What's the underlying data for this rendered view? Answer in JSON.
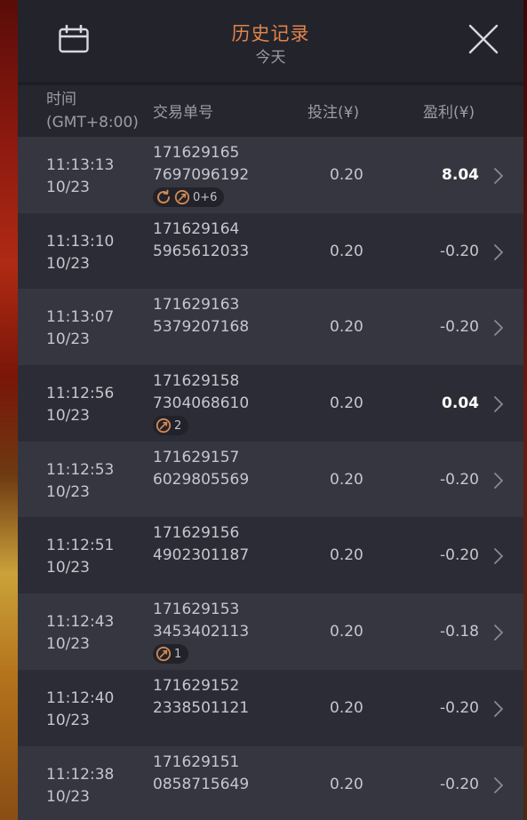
{
  "header": {
    "title": "历史记录",
    "subtitle": "今天"
  },
  "columns": {
    "time": "时间",
    "timezone": "(GMT+8:00)",
    "order": "交易单号",
    "bet": "投注(¥)",
    "profit": "盈利(¥)"
  },
  "colors": {
    "accent": "#e0844a",
    "panel_bg": "#2c2c36",
    "row_alt_bg": "#363641",
    "header_bg": "#23232b"
  },
  "rows": [
    {
      "time": "11:13:13",
      "date": "10/23",
      "order_a": "171629165",
      "order_b": "7697096192",
      "bet": "0.20",
      "profit": "8.04",
      "win": true,
      "badge": {
        "respin": true,
        "feature": true,
        "text": "0+6"
      }
    },
    {
      "time": "11:13:10",
      "date": "10/23",
      "order_a": "171629164",
      "order_b": "5965612033",
      "bet": "0.20",
      "profit": "-0.20",
      "win": false
    },
    {
      "time": "11:13:07",
      "date": "10/23",
      "order_a": "171629163",
      "order_b": "5379207168",
      "bet": "0.20",
      "profit": "-0.20",
      "win": false
    },
    {
      "time": "11:12:56",
      "date": "10/23",
      "order_a": "171629158",
      "order_b": "7304068610",
      "bet": "0.20",
      "profit": "0.04",
      "win": true,
      "badge": {
        "respin": false,
        "feature": true,
        "text": "2"
      }
    },
    {
      "time": "11:12:53",
      "date": "10/23",
      "order_a": "171629157",
      "order_b": "6029805569",
      "bet": "0.20",
      "profit": "-0.20",
      "win": false
    },
    {
      "time": "11:12:51",
      "date": "10/23",
      "order_a": "171629156",
      "order_b": "4902301187",
      "bet": "0.20",
      "profit": "-0.20",
      "win": false
    },
    {
      "time": "11:12:43",
      "date": "10/23",
      "order_a": "171629153",
      "order_b": "3453402113",
      "bet": "0.20",
      "profit": "-0.18",
      "win": false,
      "badge": {
        "respin": false,
        "feature": true,
        "text": "1"
      }
    },
    {
      "time": "11:12:40",
      "date": "10/23",
      "order_a": "171629152",
      "order_b": "2338501121",
      "bet": "0.20",
      "profit": "-0.20",
      "win": false
    },
    {
      "time": "11:12:38",
      "date": "10/23",
      "order_a": "171629151",
      "order_b": "0858715649",
      "bet": "0.20",
      "profit": "-0.20",
      "win": false
    }
  ]
}
